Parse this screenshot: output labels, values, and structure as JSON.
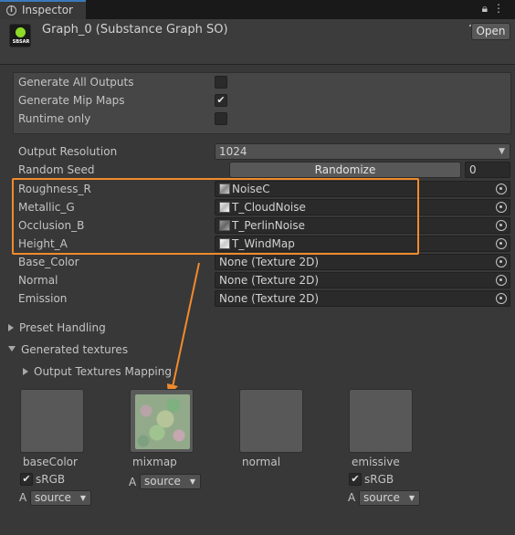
{
  "tab": {
    "label": "Inspector"
  },
  "header": {
    "title": "Graph_0 (Substance Graph SO)",
    "logo_text": "SBSAR",
    "open_label": "Open"
  },
  "options": [
    {
      "label": "Generate All Outputs",
      "checked": false
    },
    {
      "label": "Generate Mip Maps",
      "checked": true
    },
    {
      "label": "Runtime only",
      "checked": false
    }
  ],
  "output_resolution": {
    "label": "Output Resolution",
    "value": "1024"
  },
  "random_seed": {
    "label": "Random Seed",
    "button": "Randomize",
    "value": "0"
  },
  "texture_inputs": [
    {
      "label": "Roughness_R",
      "value": "NoiseC"
    },
    {
      "label": "Metallic_G",
      "value": "T_CloudNoise"
    },
    {
      "label": "Occlusion_B",
      "value": "T_PerlinNoise"
    },
    {
      "label": "Height_A",
      "value": "T_WindMap"
    },
    {
      "label": "Base_Color",
      "value": "None (Texture 2D)"
    },
    {
      "label": "Normal",
      "value": "None (Texture 2D)"
    },
    {
      "label": "Emission",
      "value": "None (Texture 2D)"
    }
  ],
  "foldouts": {
    "preset": "Preset Handling",
    "generated": "Generated textures",
    "mapping": "Output Textures Mapping"
  },
  "outputs": [
    {
      "name": "baseColor",
      "srgb_label": "sRGB",
      "alpha_prefix": "A",
      "source": "source"
    },
    {
      "name": "mixmap",
      "alpha_prefix": "A",
      "source": "source"
    },
    {
      "name": "normal"
    },
    {
      "name": "emissive",
      "srgb_label": "sRGB",
      "alpha_prefix": "A",
      "source": "source"
    }
  ],
  "colors": {
    "highlight": "#f28a2b",
    "arrow": "#f28a2b",
    "accent": "#3a79bb"
  },
  "icons": [
    "info-icon",
    "lock-icon",
    "kebab-menu-icon",
    "help-icon",
    "settings-icon",
    "object-picker-icon",
    "checkmark-icon",
    "dropdown-arrow-icon"
  ]
}
